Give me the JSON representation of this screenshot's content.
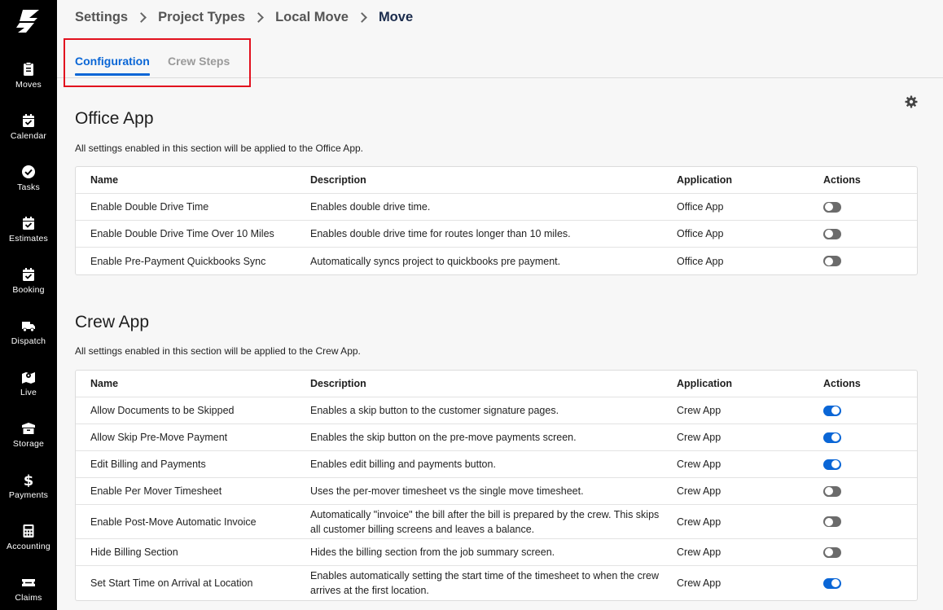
{
  "sidebar": {
    "items": [
      {
        "label": "Moves",
        "icon": "clipboard-icon"
      },
      {
        "label": "Calendar",
        "icon": "calendar-check-icon"
      },
      {
        "label": "Tasks",
        "icon": "check-circle-icon"
      },
      {
        "label": "Estimates",
        "icon": "calendar-check-icon"
      },
      {
        "label": "Booking",
        "icon": "calendar-check-icon"
      },
      {
        "label": "Dispatch",
        "icon": "truck-icon"
      },
      {
        "label": "Live",
        "icon": "map-icon"
      },
      {
        "label": "Storage",
        "icon": "box-icon"
      },
      {
        "label": "Payments",
        "icon": "dollar-icon"
      },
      {
        "label": "Accounting",
        "icon": "calculator-icon"
      },
      {
        "label": "Claims",
        "icon": "ticket-icon"
      }
    ]
  },
  "breadcrumb": [
    "Settings",
    "Project Types",
    "Local Move",
    "Move"
  ],
  "tabs": {
    "configuration": "Configuration",
    "crew_steps": "Crew Steps"
  },
  "headers": {
    "name": "Name",
    "description": "Description",
    "application": "Application",
    "actions": "Actions"
  },
  "office": {
    "title": "Office App",
    "description": "All settings enabled in this section will be applied to the Office App.",
    "rows": [
      {
        "name": "Enable Double Drive Time",
        "description": "Enables double drive time.",
        "application": "Office App",
        "enabled": false
      },
      {
        "name": "Enable Double Drive Time Over 10 Miles",
        "description": "Enables double drive time for routes longer than 10 miles.",
        "application": "Office App",
        "enabled": false
      },
      {
        "name": "Enable Pre-Payment Quickbooks Sync",
        "description": "Automatically syncs project to quickbooks pre payment.",
        "application": "Office App",
        "enabled": false
      }
    ]
  },
  "crew": {
    "title": "Crew App",
    "description": "All settings enabled in this section will be applied to the Crew App.",
    "rows": [
      {
        "name": "Allow Documents to be Skipped",
        "description": "Enables a skip button to the customer signature pages.",
        "application": "Crew App",
        "enabled": true
      },
      {
        "name": "Allow Skip Pre-Move Payment",
        "description": "Enables the skip button on the pre-move payments screen.",
        "application": "Crew App",
        "enabled": true
      },
      {
        "name": "Edit Billing and Payments",
        "description": "Enables edit billing and payments button.",
        "application": "Crew App",
        "enabled": true
      },
      {
        "name": "Enable Per Mover Timesheet",
        "description": "Uses the per-mover timesheet vs the single move timesheet.",
        "application": "Crew App",
        "enabled": false
      },
      {
        "name": "Enable Post-Move Automatic Invoice",
        "description": "Automatically \"invoice\" the bill after the bill is prepared by the crew. This skips all customer billing screens and leaves a balance.",
        "application": "Crew App",
        "enabled": false
      },
      {
        "name": "Hide Billing Section",
        "description": "Hides the billing section from the job summary screen.",
        "application": "Crew App",
        "enabled": false
      },
      {
        "name": "Set Start Time on Arrival at Location",
        "description": "Enables automatically setting the start time of the timesheet to when the crew arrives at the first location.",
        "application": "Crew App",
        "enabled": true
      }
    ]
  },
  "colors": {
    "accent": "#0a66d6",
    "sidebar": "#000000",
    "highlight": "#e2101e",
    "toggle_off": "#6b6b6b"
  }
}
